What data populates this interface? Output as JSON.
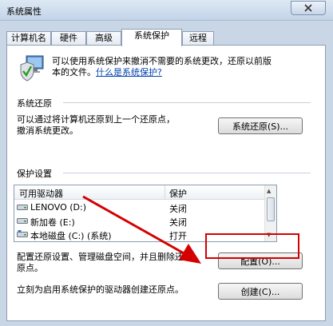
{
  "window": {
    "title": "系统属性"
  },
  "tabs": [
    {
      "label": "计算机名"
    },
    {
      "label": "硬件"
    },
    {
      "label": "高级"
    },
    {
      "label": "系统保护",
      "active": true
    },
    {
      "label": "远程"
    }
  ],
  "intro": {
    "line1": "可以使用系统保护来撤消不需要的系统更改，还原以前版",
    "line2_prefix": "本的文件。",
    "link": "什么是系统保护?"
  },
  "restore": {
    "group_title": "系统还原",
    "line1": "可以通过将计算机还原到上一个还原点，",
    "line2": "撤消系统更改。",
    "button": "系统还原(S)..."
  },
  "protection": {
    "group_title": "保护设置",
    "columns": [
      "可用驱动器",
      "保护"
    ],
    "drives": [
      {
        "name": "LENOVO (D:)",
        "status": "关闭"
      },
      {
        "name": "新加卷 (E:)",
        "status": "关闭"
      },
      {
        "name": "本地磁盘 (C:) (系统)",
        "status": "打开"
      }
    ],
    "config_line1": "配置还原设置、管理磁盘空间，并且删除还",
    "config_line2": "原点。",
    "config_button": "配置(O)...",
    "create_text": "立刻为启用系统保护的驱动器创建还原点。",
    "create_button": "创建(C)..."
  },
  "colors": {
    "annotation": "#d40000",
    "link": "#0645ad"
  },
  "icons": [
    "close-icon",
    "system-protection-icon",
    "drive-icon",
    "scroll-up-icon",
    "scroll-down-icon"
  ]
}
